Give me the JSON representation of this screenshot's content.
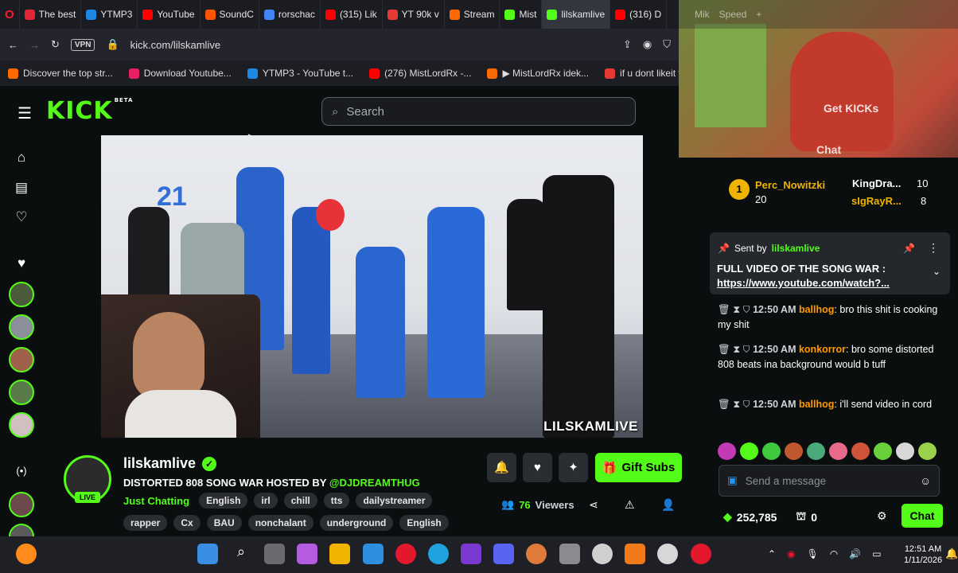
{
  "browser": {
    "tabs": [
      {
        "label": "The best",
        "color": "#e32636"
      },
      {
        "label": "YTMP3",
        "color": "#1e88e5"
      },
      {
        "label": "YouTube",
        "color": "#ff0000"
      },
      {
        "label": "SoundC",
        "color": "#ff5500"
      },
      {
        "label": "rorschac",
        "color": "#4285f4"
      },
      {
        "label": "(315) Lik",
        "color": "#ff0000"
      },
      {
        "label": "YT 90k v",
        "color": "#e53935"
      },
      {
        "label": "Stream",
        "color": "#ff6a00"
      },
      {
        "label": "Mist",
        "color": "#53fc18"
      },
      {
        "label": "lilskamlive",
        "color": "#53fc18"
      },
      {
        "label": "(316) D",
        "color": "#ff0000"
      }
    ],
    "vpn_label": "VPN",
    "url": "kick.com/lilskamlive",
    "bookmarks": [
      {
        "label": "Discover the top str...",
        "color": "#ff6a00"
      },
      {
        "label": "Download Youtube...",
        "color": "#e91e63"
      },
      {
        "label": "YTMP3 - YouTube t...",
        "color": "#1e88e5"
      },
      {
        "label": "(276) MistLordRx -...",
        "color": "#ff0000"
      },
      {
        "label": "▶ MistLordRx idek...",
        "color": "#ff6a00"
      },
      {
        "label": "if u dont likeit you b...",
        "color": "#e53935"
      }
    ]
  },
  "kick": {
    "logo_text": "KICK",
    "logo_sup": "BETA",
    "search_placeholder": "Search"
  },
  "video": {
    "watermark": "LILSKAMLIVE",
    "jersey_number": "21"
  },
  "channel": {
    "live_badge": "LIVE",
    "name": "lilskamlive",
    "title_prefix": "DISTORTED 808 SONG WAR HOSTED BY ",
    "title_highlight": "@DJDREAMTHUG",
    "category": "Just Chatting",
    "tags_row1": [
      "English",
      "irl",
      "chill",
      "tts",
      "dailystreamer"
    ],
    "tags_row2": [
      "rapper",
      "Cx",
      "BAU",
      "nonchalant",
      "underground",
      "English"
    ],
    "gift_label": "Gift Subs",
    "viewer_count": "76",
    "viewer_label": "Viewers"
  },
  "overlay": {
    "tabs": [
      "Mik",
      "Speed"
    ],
    "get_kicks": "Get KICKs",
    "chat_label": "Chat"
  },
  "chat": {
    "leaderboard": {
      "first_rank": "1",
      "first_name": "Perc_Nowitzki",
      "first_value": "20",
      "second_name": "KingDra...",
      "second_value": "10",
      "third_name": "sIgRayR...",
      "third_value": "8"
    },
    "pinned": {
      "sent_by_label": "Sent by",
      "sender": "lilskamlive",
      "text": "FULL VIDEO OF THE SONG WAR :",
      "link": "https://www.youtube.com/watch?..."
    },
    "messages": [
      {
        "time": "12:50 AM",
        "user": "ballhog",
        "user_color": "#ff9900",
        "text": "bro this shit is cooking my shit"
      },
      {
        "time": "12:50 AM",
        "user": "konkorror",
        "user_color": "#ff9900",
        "text": "bro some distorted 808 beats ina background would b tuff"
      },
      {
        "time": "12:50 AM",
        "user": "ballhog",
        "user_color": "#ff9900",
        "text": "i'll send video in cord"
      }
    ],
    "input_placeholder": "Send a message",
    "kicks_balance": "252,785",
    "drops_count": "0",
    "chat_button": "Chat"
  },
  "taskbar": {
    "time": "12:51 AM",
    "date": "1/11/2026"
  }
}
